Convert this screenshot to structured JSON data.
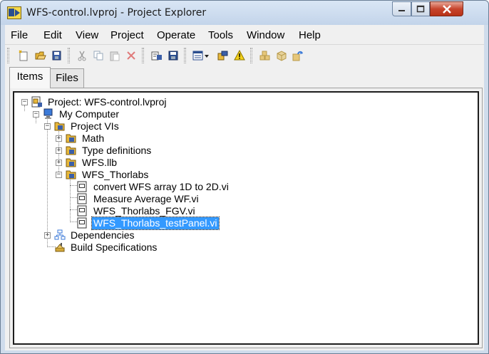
{
  "window": {
    "title": "WFS-control.lvproj - Project Explorer",
    "controls": {
      "minimize": "minimize",
      "maximize": "maximize",
      "close": "close"
    }
  },
  "menu": [
    "File",
    "Edit",
    "View",
    "Project",
    "Operate",
    "Tools",
    "Window",
    "Help"
  ],
  "toolbar": [
    "new-icon",
    "open-icon",
    "save-all-icon",
    "cut-icon",
    "copy-icon",
    "paste-icon",
    "delete-icon",
    "project-properties-icon",
    "save-project-icon",
    "view-dropdown-icon",
    "resolve-conflicts-icon",
    "warning-icon",
    "build-icon",
    "deploy-icon",
    "refresh-icon"
  ],
  "tabs": {
    "items": "Items",
    "files": "Files",
    "active": "Items"
  },
  "tree": {
    "project": "Project: WFS-control.lvproj",
    "computer": "My Computer",
    "project_vis": "Project VIs",
    "folders": [
      "Math",
      "Type definitions",
      "WFS.llb",
      "WFS_Thorlabs"
    ],
    "vis": [
      "convert WFS array 1D to 2D.vi",
      "Measure Average WF.vi",
      "WFS_Thorlabs_FGV.vi",
      "WFS_Thorlabs_testPanel.vi"
    ],
    "selected": "WFS_Thorlabs_testPanel.vi",
    "dependencies": "Dependencies",
    "build_specs": "Build Specifications"
  },
  "colors": {
    "selection": "#3399ff",
    "close_button": "#c7452d",
    "folder": "#e8b83a"
  }
}
